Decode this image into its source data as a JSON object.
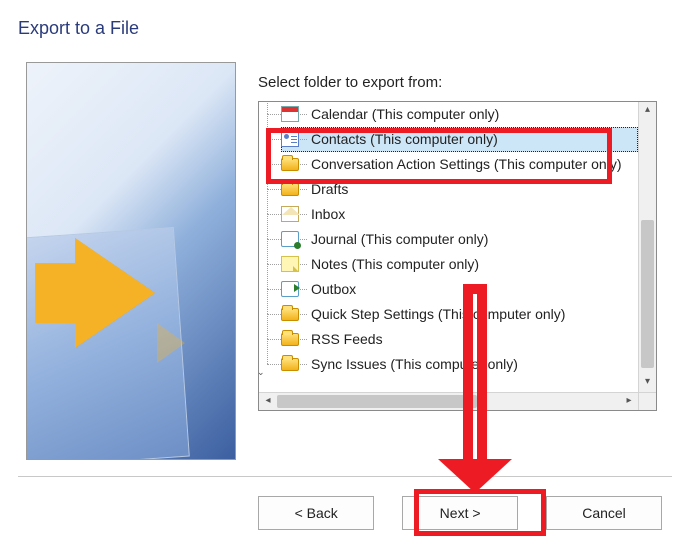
{
  "title": "Export to a File",
  "instruction": "Select folder to export from:",
  "tree": {
    "items": [
      {
        "label": "Calendar (This computer only)",
        "icon": "calendar-icon"
      },
      {
        "label": "Contacts (This computer only)",
        "icon": "contacts-icon",
        "selected": true
      },
      {
        "label": "Conversation Action Settings (This computer only)",
        "icon": "folder-icon"
      },
      {
        "label": "Drafts",
        "icon": "folder-icon"
      },
      {
        "label": "Inbox",
        "icon": "inbox-icon"
      },
      {
        "label": "Journal (This computer only)",
        "icon": "journal-icon"
      },
      {
        "label": "Notes (This computer only)",
        "icon": "notes-icon"
      },
      {
        "label": "Outbox",
        "icon": "outbox-icon"
      },
      {
        "label": "Quick Step Settings (This computer only)",
        "icon": "folder-icon"
      },
      {
        "label": "RSS Feeds",
        "icon": "folder-icon"
      },
      {
        "label": "Sync Issues (This computer only)",
        "icon": "folder-icon",
        "expandable": true
      }
    ]
  },
  "buttons": {
    "back": "<  Back",
    "next": "Next  >",
    "cancel": "Cancel"
  },
  "annotation": {
    "highlight_item": "Contacts (This computer only)",
    "highlight_button": "Next",
    "color": "#ed1c24"
  }
}
